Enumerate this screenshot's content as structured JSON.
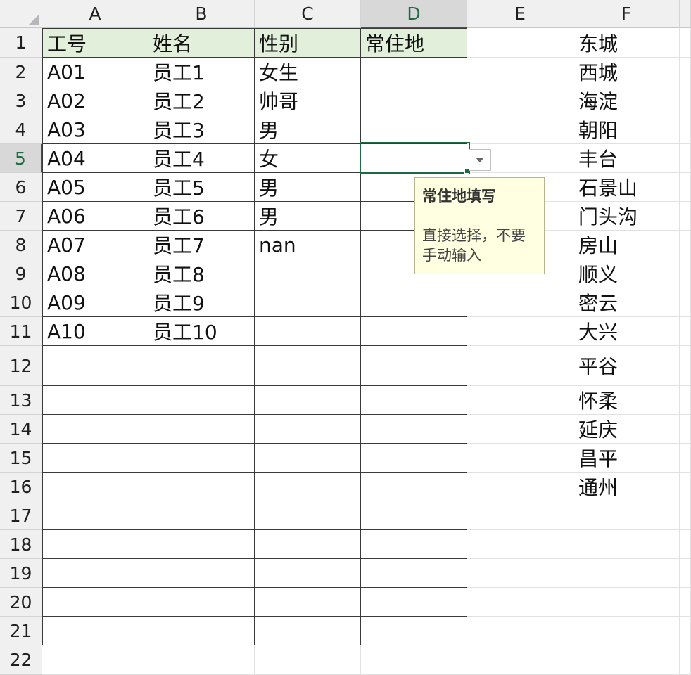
{
  "columns": [
    "A",
    "B",
    "C",
    "D",
    "E",
    "F"
  ],
  "selected_column": "D",
  "rows": [
    "1",
    "2",
    "3",
    "4",
    "5",
    "6",
    "7",
    "8",
    "9",
    "10",
    "11",
    "12",
    "13",
    "14",
    "15",
    "16",
    "17",
    "18",
    "19",
    "20",
    "21",
    "22"
  ],
  "selected_row": "5",
  "table": {
    "headers": [
      "工号",
      "姓名",
      "性别",
      "常住地"
    ],
    "records": [
      [
        "A01",
        "员工1",
        "女生",
        ""
      ],
      [
        "A02",
        "员工2",
        "帅哥",
        ""
      ],
      [
        "A03",
        "员工3",
        "男",
        ""
      ],
      [
        "A04",
        "员工4",
        "女",
        ""
      ],
      [
        "A05",
        "员工5",
        "男",
        ""
      ],
      [
        "A06",
        "员工6",
        "男",
        ""
      ],
      [
        "A07",
        "员工7",
        "nan",
        ""
      ],
      [
        "A08",
        "员工8",
        "",
        ""
      ],
      [
        "A09",
        "员工9",
        "",
        ""
      ],
      [
        "A10",
        "员工10",
        "",
        ""
      ]
    ]
  },
  "list_f": [
    "东城",
    "西城",
    "海淀",
    "朝阳",
    "丰台",
    "石景山",
    "门头沟",
    "房山",
    "顺义",
    "密云",
    "大兴",
    "平谷",
    "怀柔",
    "延庆",
    "昌平",
    "通州"
  ],
  "tooltip": {
    "title": "常住地填写",
    "body": "直接选择，不要手动输入"
  },
  "colors": {
    "accent": "#1e6b43",
    "header_fill": "#e2efda",
    "tooltip_bg": "#ffffe1"
  },
  "icons": {
    "dropdown": "chevron-down-icon",
    "select_all": "select-all-triangle-icon"
  }
}
